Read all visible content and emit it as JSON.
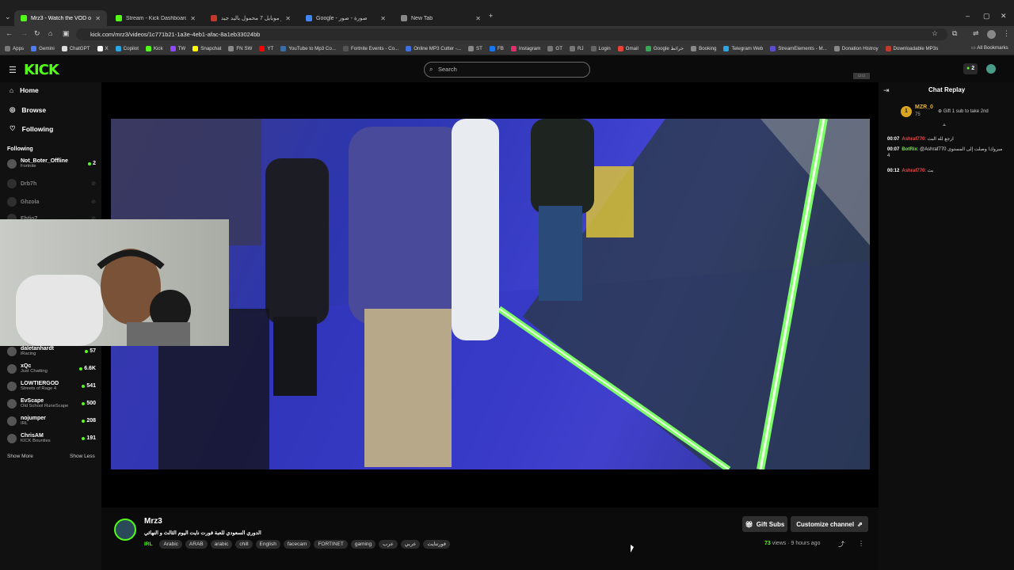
{
  "browser": {
    "tabs": [
      {
        "label": "Mrz3 - Watch the VOD on",
        "active": true,
        "color": "#53fc18"
      },
      {
        "label": "Stream - Kick Dashboard",
        "active": false,
        "color": "#53fc18"
      },
      {
        "label": "اوسمو موبايل 7 محمول باليد جيد...",
        "active": false,
        "color": "#c0392b"
      },
      {
        "label": "Google - صورة - صور",
        "active": false,
        "color": "#4285f4"
      },
      {
        "label": "New Tab",
        "active": false,
        "color": "#888888"
      }
    ],
    "url": "kick.com/mrz3/videos/1c771b21-1a3e-4eb1-afac-8a1eb33024bb",
    "bookmarks": [
      {
        "label": "Apps",
        "color": "#7a7a7a"
      },
      {
        "label": "Gemini",
        "color": "#4e7cf4"
      },
      {
        "label": "ChatGPT",
        "color": "#dddddd"
      },
      {
        "label": "X",
        "color": "#ffffff"
      },
      {
        "label": "Copilot",
        "color": "#2ca5e0"
      },
      {
        "label": "Kick",
        "color": "#53fc18"
      },
      {
        "label": "TW",
        "color": "#9146ff"
      },
      {
        "label": "Snapchat",
        "color": "#fffc00"
      },
      {
        "label": "FN SW",
        "color": "#8a8a8a"
      },
      {
        "label": "YT",
        "color": "#ff0000"
      },
      {
        "label": "YouTube to Mp3 Co...",
        "color": "#3a6ea5"
      },
      {
        "label": "Fortnite Events - Co...",
        "color": "#555555"
      },
      {
        "label": "Online MP3 Cutter -...",
        "color": "#3f6fe0"
      },
      {
        "label": "ST",
        "color": "#888888"
      },
      {
        "label": "FB",
        "color": "#1877f2"
      },
      {
        "label": "Instagram",
        "color": "#e1306c"
      },
      {
        "label": "GT",
        "color": "#777777"
      },
      {
        "label": "RJ",
        "color": "#777777"
      },
      {
        "label": "Login",
        "color": "#666666"
      },
      {
        "label": "Gmail",
        "color": "#ea4335"
      },
      {
        "label": "Google خرائط",
        "color": "#34a853"
      },
      {
        "label": "Booking",
        "color": "#888888"
      },
      {
        "label": "Telegram Web",
        "color": "#2ca5e0"
      },
      {
        "label": "StreamElements - M...",
        "color": "#5a4fcf"
      },
      {
        "label": "Donation Histroy",
        "color": "#888888"
      },
      {
        "label": "Downloadable MP3s",
        "color": "#c0392b"
      }
    ],
    "all_bookmarks": "All Bookmarks"
  },
  "header": {
    "logo": "KICK",
    "search_placeholder": "Search",
    "badge_count": "2"
  },
  "sidebar": {
    "nav": [
      {
        "label": "Home",
        "icon": "home-icon"
      },
      {
        "label": "Browse",
        "icon": "compass-icon"
      },
      {
        "label": "Following",
        "icon": "heart-icon"
      }
    ],
    "following_title": "Following",
    "channels": [
      {
        "name": "Not_Boter_Offline",
        "game": "Fortnite",
        "viewers": "2",
        "live": true
      },
      {
        "name": "Drb7h",
        "game": "",
        "viewers": "",
        "live": false
      },
      {
        "name": "Ghzola",
        "game": "",
        "viewers": "",
        "live": false
      },
      {
        "name": "Ehtio7",
        "game": "",
        "viewers": "",
        "live": false
      },
      {
        "name": "daletanhardt",
        "game": "iRacing",
        "viewers": "57",
        "live": true
      },
      {
        "name": "xQc",
        "game": "Just Chatting",
        "viewers": "6.6K",
        "live": true
      },
      {
        "name": "LOWTIERGOD",
        "game": "Streets of Rage 4",
        "viewers": "541",
        "live": true
      },
      {
        "name": "EvScape",
        "game": "Old School RuneScape",
        "viewers": "500",
        "live": true
      },
      {
        "name": "nojumper",
        "game": "IRL",
        "viewers": "208",
        "live": true
      },
      {
        "name": "ChrisAM",
        "game": "KICK Bounties",
        "viewers": "191",
        "live": true
      }
    ],
    "show_more": "Show More",
    "show_less": "Show Less"
  },
  "chat": {
    "title": "Chat Replay",
    "pinned_user": "MZR_0",
    "pinned_count": "75",
    "pinned_text": "Gift 1 sub to take 2nd",
    "messages": [
      {
        "time": "00:07",
        "user": "Ashraf770",
        "user_color": "#e34b4b",
        "text": "ارجع لله البث"
      },
      {
        "time": "00:07",
        "user": "BotRix",
        "user_color": "#53fc18",
        "text": "@Ashraf770 مبروك! وصلت إلى المستوى 4"
      },
      {
        "time": "00:12",
        "user": "Ashraf770",
        "user_color": "#e34b4b",
        "text": "بث"
      }
    ]
  },
  "channel": {
    "name": "Mrz3",
    "title": "الدوري السعودي للعبة فورت نايت اليوم الثالث و النهائي",
    "tags": [
      "IRL",
      "Arabic",
      "ARAB",
      "arabic",
      "chill",
      "English",
      "facecam",
      "FORTINET",
      "gaming",
      "عرب",
      "عربي",
      "فورتنايت"
    ],
    "views": "73",
    "views_label": "views",
    "age": "9 hours ago",
    "gift_subs": "Gift Subs",
    "customize": "Customize channel"
  }
}
